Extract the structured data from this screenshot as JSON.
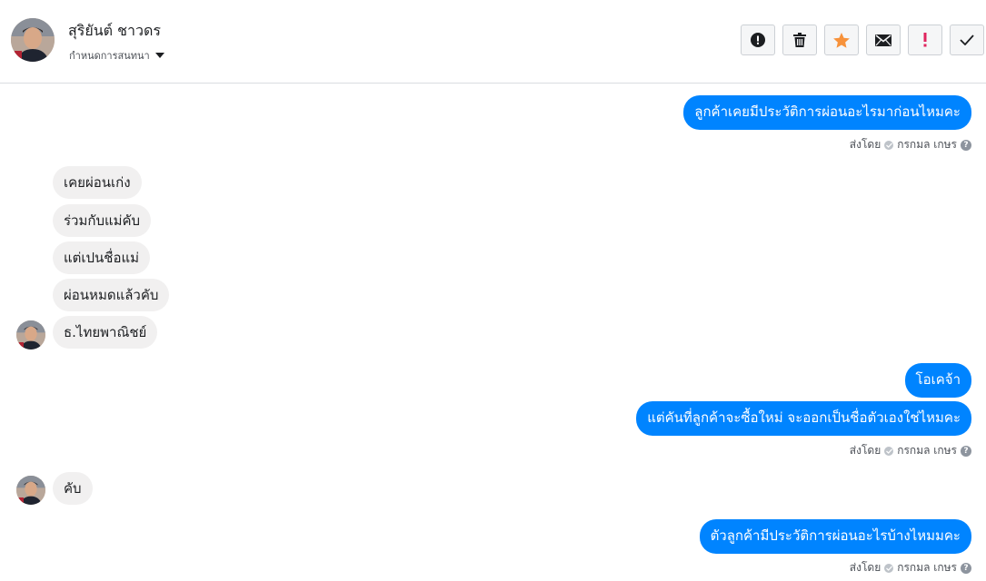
{
  "header": {
    "contact_name": "สุริยันต์ ชาวดร",
    "assign_label": "กำหนดการสนทนา"
  },
  "toolbar": [
    {
      "name": "spam-button",
      "icon": "alert-circle-icon"
    },
    {
      "name": "delete-button",
      "icon": "trash-icon"
    },
    {
      "name": "star-button",
      "icon": "star-icon"
    },
    {
      "name": "mark-unread-button",
      "icon": "envelope-icon"
    },
    {
      "name": "important-button",
      "icon": "exclamation-icon"
    },
    {
      "name": "done-button",
      "icon": "check-icon"
    }
  ],
  "colors": {
    "outgoing": "#0084ff",
    "incoming": "#f1f0f0",
    "star": "#f7923b",
    "important": "#e0245e"
  },
  "messages": {
    "m1": "ลูกค้าเคยมีประวัติการผ่อนอะไรมาก่อนไหมคะ",
    "m2": "เคยผ่อนเก่ง",
    "m3": "ร่วมกับแม่คับ",
    "m4": "แต่เปนชื่อแม่",
    "m5": "ผ่อนหมดแล้วคับ",
    "m6": "ธ.ไทยพาณิชย์",
    "m7": "โอเคจ้า",
    "m8": "แต่คันที่ลูกค้าจะซื้อใหม่ จะออกเป็นชื่อตัวเองใช่ไหมคะ",
    "m9": "คับ",
    "m10": "ตัวลูกค้ามีประวัติการผ่อนอะไรบ้างไหมมคะ"
  },
  "sent_by": {
    "prefix": "ส่งโดย",
    "name": "กรกมล เกษร"
  }
}
